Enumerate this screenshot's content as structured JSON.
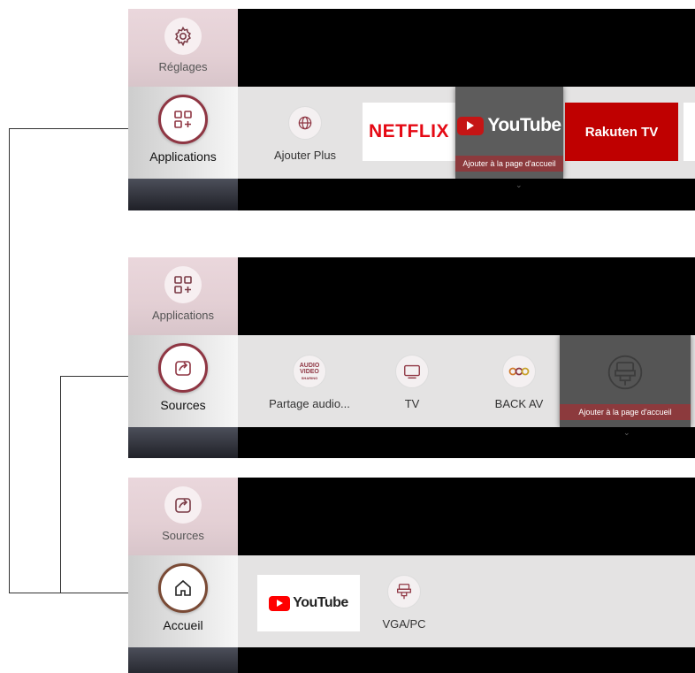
{
  "panel1": {
    "top_label": "Réglages",
    "selected_label": "Applications",
    "add_label": "Ajouter Plus",
    "netflix": "NETFLIX",
    "youtube": "YouTube",
    "rakuten": "Rakuten TV",
    "tooltip": "Ajouter à la page d'accueil"
  },
  "panel2": {
    "top_label": "Applications",
    "selected_label": "Sources",
    "items": [
      "Partage audio...",
      "TV",
      "BACK AV"
    ],
    "audio_badge": [
      "AUDIO",
      "VIDEO",
      "SHARING"
    ],
    "tooltip": "Ajouter à la page d'accueil"
  },
  "panel3": {
    "top_label": "Sources",
    "selected_label": "Accueil",
    "youtube": "YouTube",
    "vga_label": "VGA/PC"
  },
  "colors": {
    "accent": "#8f3643",
    "tooltip": "#8c3a3d",
    "netflix": "#e50914",
    "youtube": "#ff0000",
    "rakuten": "#bf0000"
  }
}
